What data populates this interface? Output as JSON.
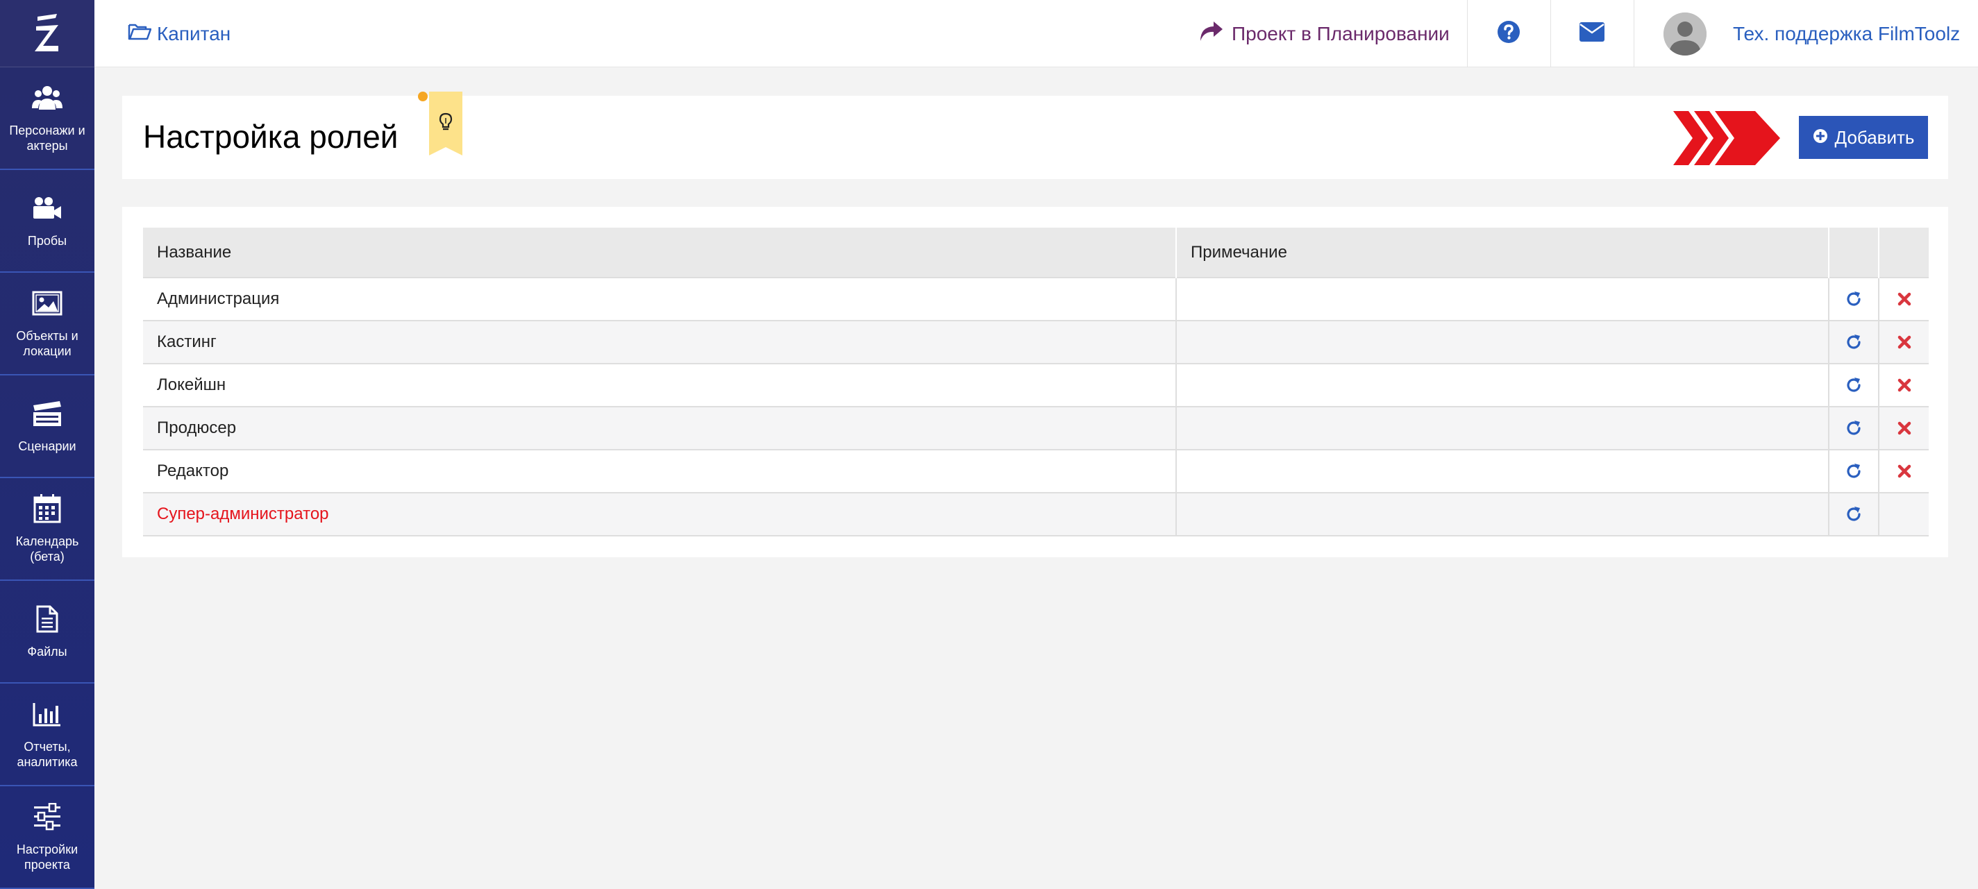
{
  "sidebar": {
    "logo_icon": "filmtoolz-logo-icon",
    "items": [
      {
        "label": "Персонажи и\nактеры",
        "icon": "users-icon"
      },
      {
        "label": "Пробы",
        "icon": "video-camera-icon"
      },
      {
        "label": "Объекты и\nлокации",
        "icon": "image-icon"
      },
      {
        "label": "Сценарии",
        "icon": "clapperboard-icon"
      },
      {
        "label": "Календарь\n(бета)",
        "icon": "calendar-icon"
      },
      {
        "label": "Файлы",
        "icon": "file-icon"
      },
      {
        "label": "Отчеты,\nаналитика",
        "icon": "bar-chart-icon"
      },
      {
        "label": "Настройки\nпроекта",
        "icon": "sliders-icon"
      }
    ]
  },
  "topbar": {
    "breadcrumb": "Капитан",
    "project_link": "Проект в Планировании",
    "user_name": "Тех. поддержка FilmToolz"
  },
  "header": {
    "title": "Настройка ролей",
    "add_button": "Добавить"
  },
  "table": {
    "columns": [
      "Название",
      "Примечание",
      "",
      ""
    ],
    "rows": [
      {
        "name": "Администрация",
        "note": "",
        "deletable": true
      },
      {
        "name": "Кастинг",
        "note": "",
        "deletable": true
      },
      {
        "name": "Локейшн",
        "note": "",
        "deletable": true
      },
      {
        "name": "Продюсер",
        "note": "",
        "deletable": true
      },
      {
        "name": "Редактор",
        "note": "",
        "deletable": true
      },
      {
        "name": "Супер-администратор",
        "note": "",
        "deletable": false
      }
    ]
  },
  "colors": {
    "sidebar_bg": "#272c6c",
    "link_blue": "#2a5fbf",
    "project_purple": "#6b2a6b",
    "accent_red": "#e5141c",
    "button_blue": "#2b55b8"
  }
}
